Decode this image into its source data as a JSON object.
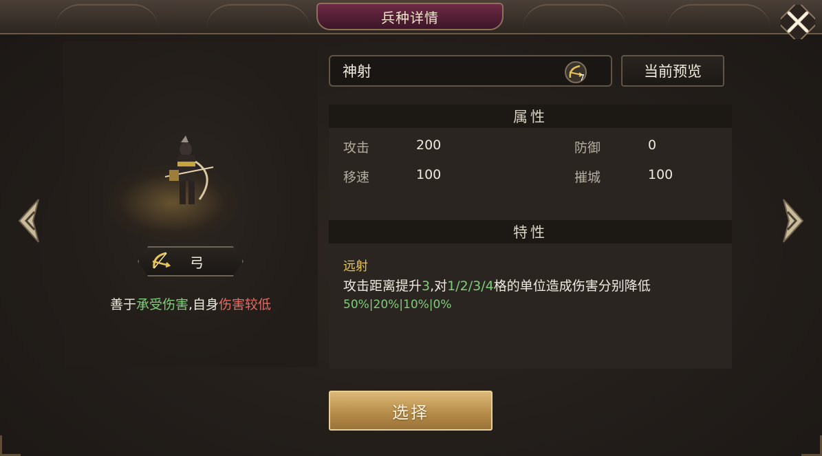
{
  "header": {
    "title": "兵种详情"
  },
  "unit": {
    "name": "神射",
    "name_icon_level": "7",
    "type_label": "弓",
    "desc_plain_1": "善于",
    "desc_green": "承受伤害",
    "desc_plain_2": ",自身",
    "desc_red": "伤害较低"
  },
  "actions": {
    "preview_label": "当前预览",
    "select_label": "选择"
  },
  "attributes": {
    "heading": "属性",
    "items": [
      {
        "label": "攻击",
        "value": "200"
      },
      {
        "label": "防御",
        "value": "0"
      },
      {
        "label": "移速",
        "value": "100"
      },
      {
        "label": "摧城",
        "value": "100"
      }
    ]
  },
  "traits": {
    "heading": "特性",
    "name": "远射",
    "desc_1": "攻击距离提升",
    "desc_num": "3",
    "desc_2": ",对",
    "desc_grid": "1/2/3/4",
    "desc_3": "格的单位造成伤害分别降低",
    "desc_pct": "50%|20%|10%|0%"
  },
  "colors": {
    "accent_gold": "#e6c45a",
    "highlight_green": "#7fce7a",
    "highlight_red": "#e46a63",
    "title_plate": "#6e2a45"
  }
}
